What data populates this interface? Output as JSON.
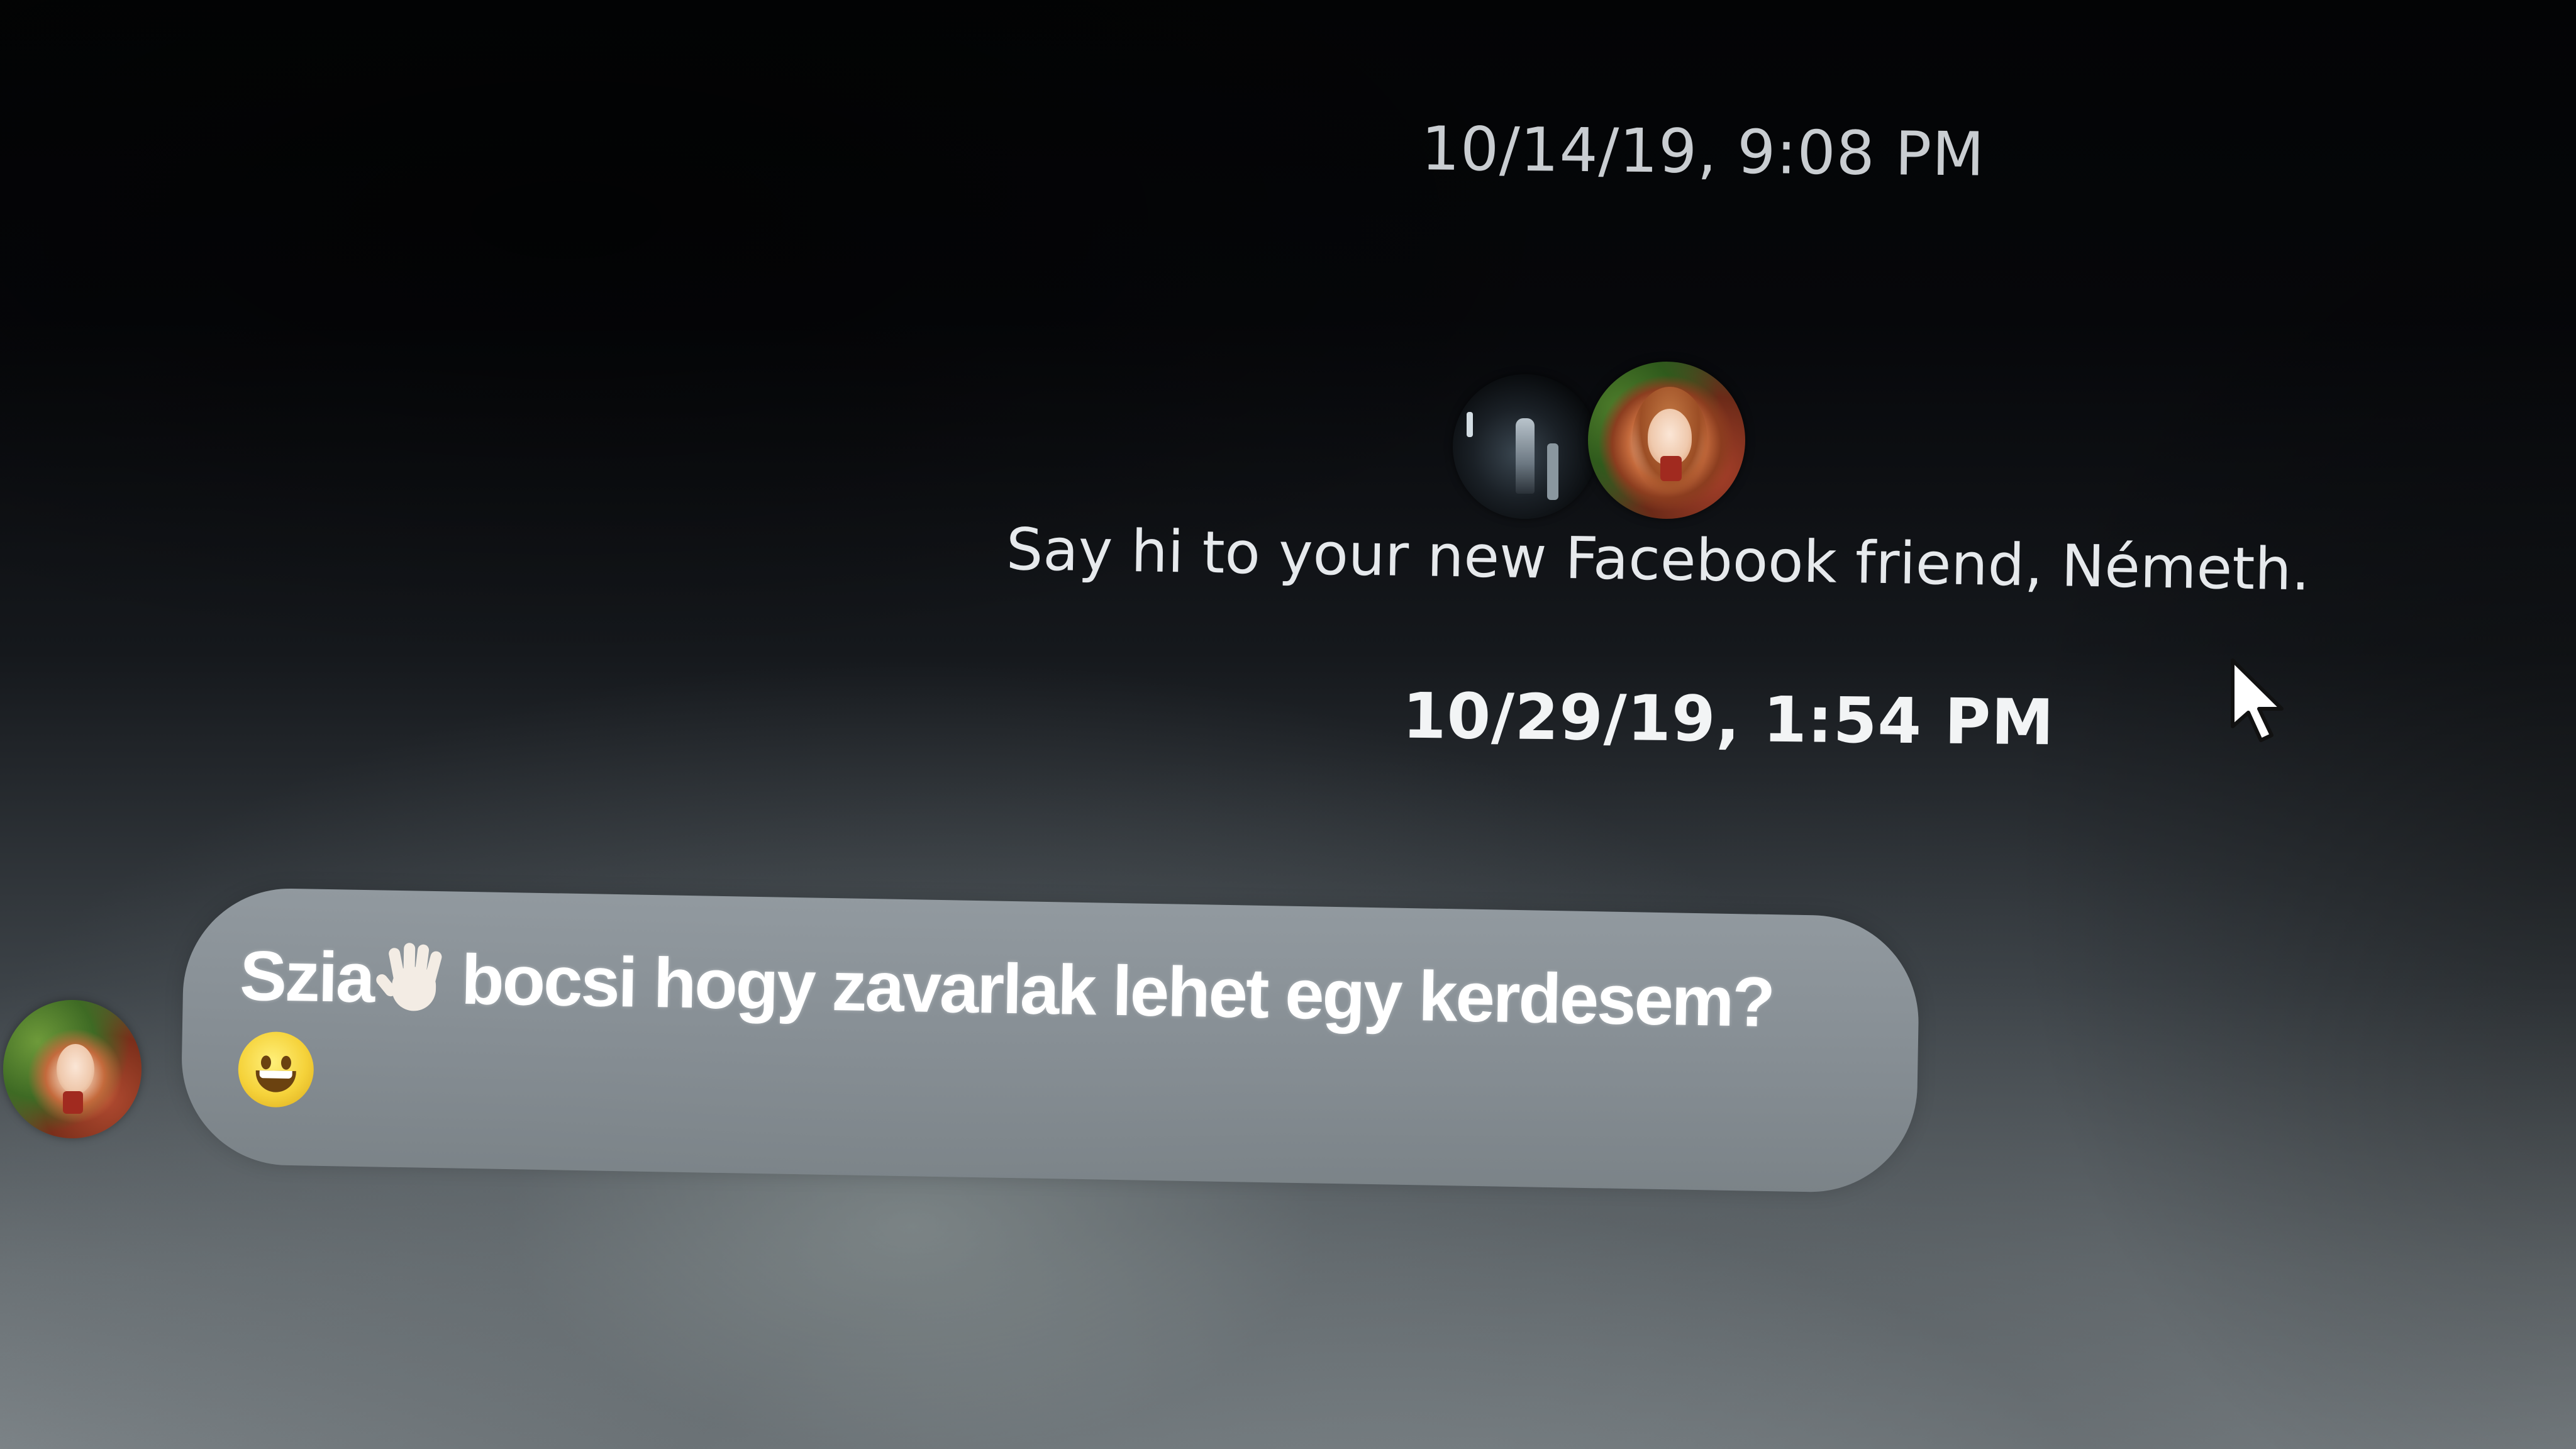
{
  "conversation": {
    "timestamp_1": "10/14/19, 9:08 PM",
    "system_message": "Say hi to your new Facebook friend, Németh.",
    "timestamp_2": "10/29/19, 1:54 PM",
    "messages": [
      {
        "text_before_emoji": "Szia",
        "emoji_1": "waving-hand",
        "text_after_emoji": "bocsi hogy zavarlak lehet egy kerdesem?",
        "emoji_2": "grinning-face"
      }
    ]
  },
  "colors": {
    "bubble": "#8e969c",
    "text": "#ffffff",
    "background_top": "#030405",
    "background_bottom": "#82898d"
  }
}
